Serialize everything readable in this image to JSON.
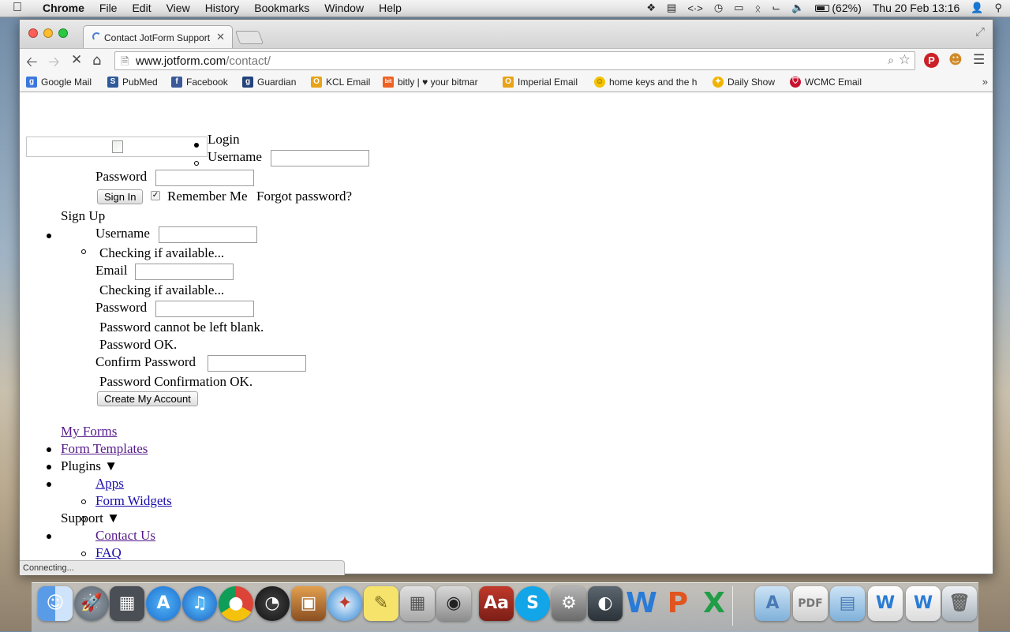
{
  "menubar": {
    "apple": "",
    "menus": [
      "Chrome",
      "File",
      "Edit",
      "View",
      "History",
      "Bookmarks",
      "Window",
      "Help"
    ],
    "battery": "(62%)",
    "datetime": "Thu 20 Feb  13:16"
  },
  "browser": {
    "tab_title": "Contact JotForm Support",
    "url_host": "www.jotform.com",
    "url_path": "/contact/",
    "bookmarks": [
      {
        "label": "Google Mail",
        "icon": "google-icon",
        "color": "#3b77dd"
      },
      {
        "label": "PubMed",
        "icon": "pubmed-icon",
        "color": "#2e5a9b"
      },
      {
        "label": "Facebook",
        "icon": "facebook-icon",
        "color": "#3b5998"
      },
      {
        "label": "Guardian",
        "icon": "guardian-icon",
        "color": "#24437a"
      },
      {
        "label": "KCL Email",
        "icon": "outlook-icon",
        "color": "#e8a317"
      },
      {
        "label": "bitly | ♥ your bitmar",
        "icon": "bitly-icon",
        "color": "#ee6123"
      },
      {
        "label": "Imperial Email",
        "icon": "outlook-icon",
        "color": "#e8a317"
      },
      {
        "label": "home keys and the h",
        "icon": "smiley-icon",
        "color": "#f3c300"
      },
      {
        "label": "Daily Show",
        "icon": "daily-show-icon",
        "color": "#f0b400"
      },
      {
        "label": "WCMC Email",
        "icon": "wcmc-icon",
        "color": "#c8102e"
      }
    ],
    "status": "Connecting..."
  },
  "page": {
    "login": {
      "heading": "Login",
      "username_label": "Username",
      "username_value": "",
      "password_label": "Password",
      "password_value": "",
      "sign_in": "Sign In",
      "remember": "Remember Me",
      "forgot": "Forgot password?"
    },
    "signup": {
      "heading": "Sign Up",
      "username_label": "Username",
      "username_value": "",
      "username_check": "Checking if available...",
      "email_label": "Email",
      "email_value": "",
      "email_check": "Checking if available...",
      "password_label": "Password",
      "password_value": "",
      "password_blank": "Password cannot be left blank.",
      "password_ok": "Password OK.",
      "confirm_label": "Confirm Password",
      "confirm_value": "",
      "confirm_ok": "Password Confirmation OK.",
      "create": "Create My Account"
    },
    "nav": {
      "my_forms": "My Forms",
      "form_templates": "Form Templates",
      "plugins": "Plugins ▼",
      "apps": "Apps",
      "form_widgets": "Form Widgets",
      "support": "Support ▼",
      "contact_us": "Contact Us",
      "faq": "FAQ"
    }
  }
}
